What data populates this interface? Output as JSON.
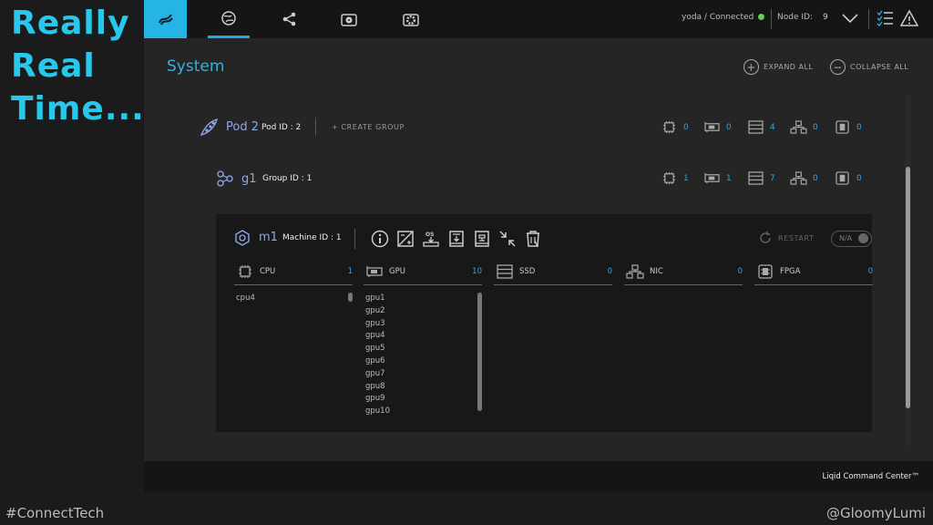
{
  "slide": {
    "title_lines": [
      "Really",
      "Real",
      "Time..."
    ],
    "hashtag": "#ConnectTech",
    "handle": "@GloomyLumi"
  },
  "topbar": {
    "connection": "yoda / Connected",
    "node_id_label": "Node ID:",
    "node_id_value": "9",
    "tabs": [
      "logo-icon",
      "globe-icon",
      "share-icon",
      "folder-disk-icon",
      "gear-folder-icon"
    ]
  },
  "page": {
    "title": "System",
    "expand_all": "EXPAND ALL",
    "collapse_all": "COLLAPSE ALL"
  },
  "pod": {
    "label": "Pod 2",
    "id": "Pod ID : 2",
    "create_group": "+ CREATE GROUP",
    "stats": [
      "0",
      "0",
      "4",
      "0",
      "0"
    ]
  },
  "group": {
    "label": "g1",
    "id": "Group ID : 1",
    "stats": [
      "1",
      "1",
      "7",
      "0",
      "0"
    ]
  },
  "machine": {
    "label": "m1",
    "id": "Machine ID : 1",
    "restart": "RESTART",
    "toggle": "N/A",
    "columns": [
      {
        "name": "CPU",
        "count": "1",
        "items": [
          "cpu4"
        ]
      },
      {
        "name": "GPU",
        "count": "10",
        "items": [
          "gpu1",
          "gpu2",
          "gpu3",
          "gpu4",
          "gpu5",
          "gpu6",
          "gpu7",
          "gpu8",
          "gpu9",
          "gpu10"
        ]
      },
      {
        "name": "SSD",
        "count": "0",
        "items": []
      },
      {
        "name": "NIC",
        "count": "0",
        "items": []
      },
      {
        "name": "FPGA",
        "count": "0",
        "items": []
      }
    ]
  },
  "footer": {
    "brand": "Liqid Command Center™"
  },
  "colors": {
    "accent": "#2db3e5",
    "title_cyan": "#28c8ec",
    "connected": "#5fcf4f"
  }
}
